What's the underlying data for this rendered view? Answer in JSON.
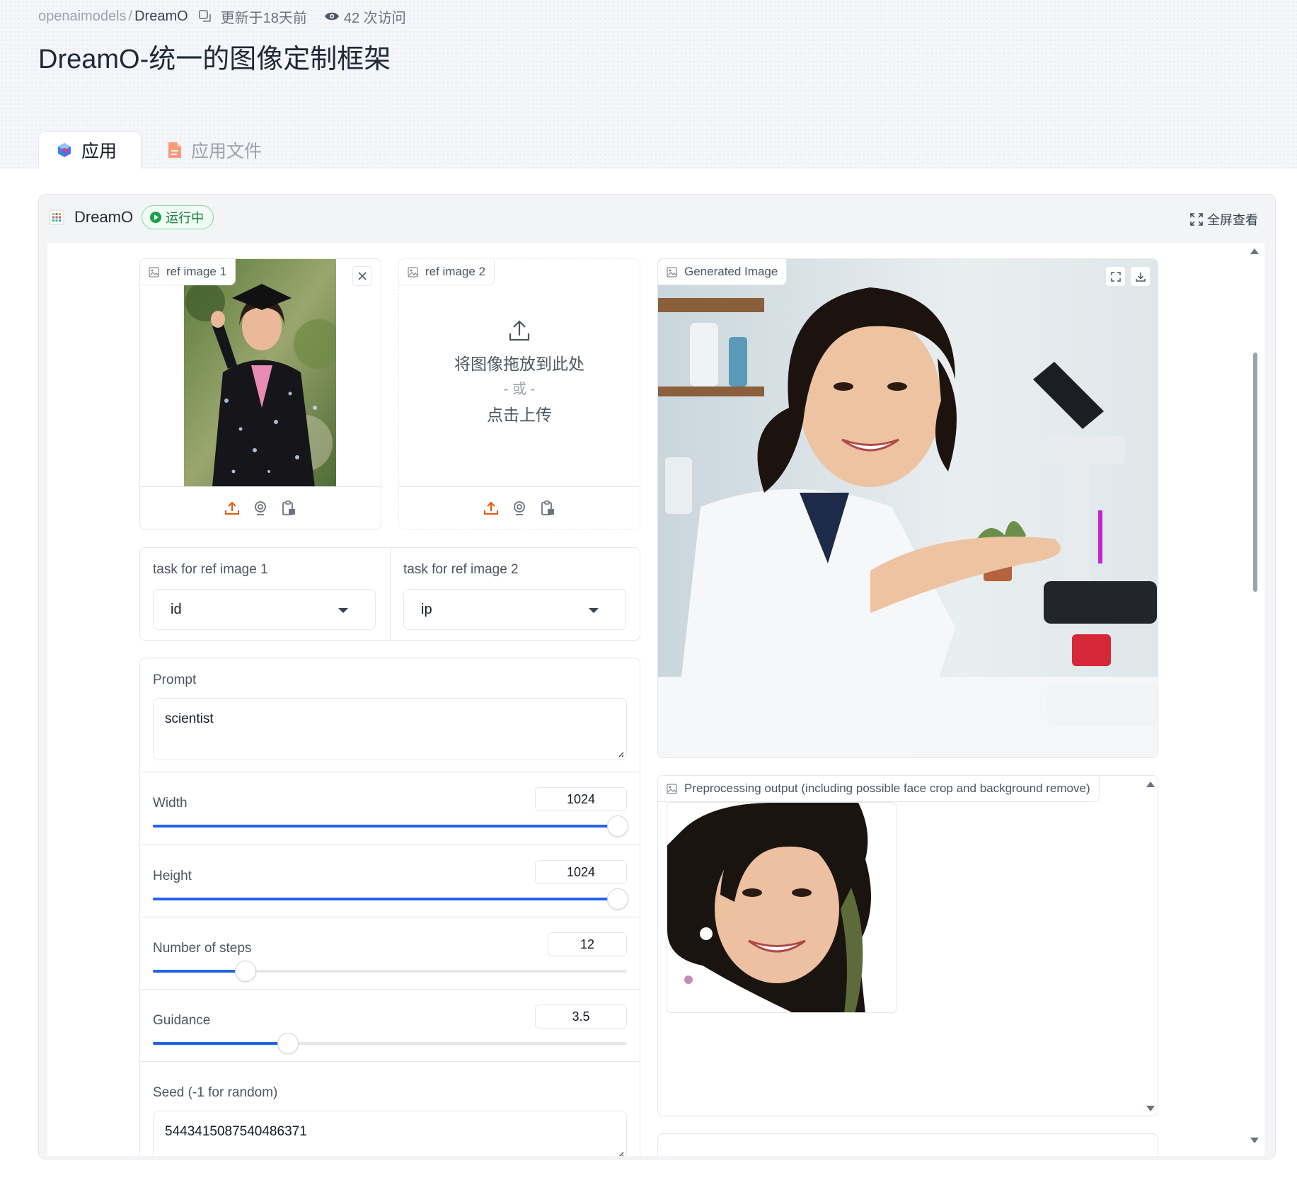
{
  "header": {
    "owner": "openaimodels",
    "repo": "DreamO",
    "updated": "更新于18天前",
    "visits": "42 次访问",
    "title": "DreamO-统一的图像定制框架"
  },
  "tabs": [
    {
      "label": "应用",
      "active": true
    },
    {
      "label": "应用文件",
      "active": false
    }
  ],
  "app": {
    "name": "DreamO",
    "status": "运行中",
    "fullscreen": "全屏查看"
  },
  "ref_image_1": {
    "label": "ref image 1"
  },
  "ref_image_2": {
    "label": "ref image 2",
    "drop_text": "将图像拖放到此处",
    "or_text": "- 或 -",
    "click_text": "点击上传"
  },
  "tasks": [
    {
      "label": "task for ref image 1",
      "value": "id"
    },
    {
      "label": "task for ref image 2",
      "value": "ip"
    }
  ],
  "prompt": {
    "label": "Prompt",
    "value": "scientist"
  },
  "sliders": {
    "width": {
      "label": "Width",
      "value": "1024",
      "fraction": 0.98
    },
    "height": {
      "label": "Height",
      "value": "1024",
      "fraction": 0.98
    },
    "steps": {
      "label": "Number of steps",
      "value": "12",
      "fraction": 0.195
    },
    "guidance": {
      "label": "Guidance",
      "value": "3.5",
      "fraction": 0.285
    }
  },
  "seed": {
    "label": "Seed (-1 for random)",
    "value": "5443415087540486371"
  },
  "generated": {
    "label": "Generated Image"
  },
  "preprocess": {
    "label": "Preprocessing output (including possible face crop and background remove)"
  },
  "colors": {
    "accent": "#2563eb",
    "upload_icon": "#ea580c",
    "status": "#16a34a"
  }
}
